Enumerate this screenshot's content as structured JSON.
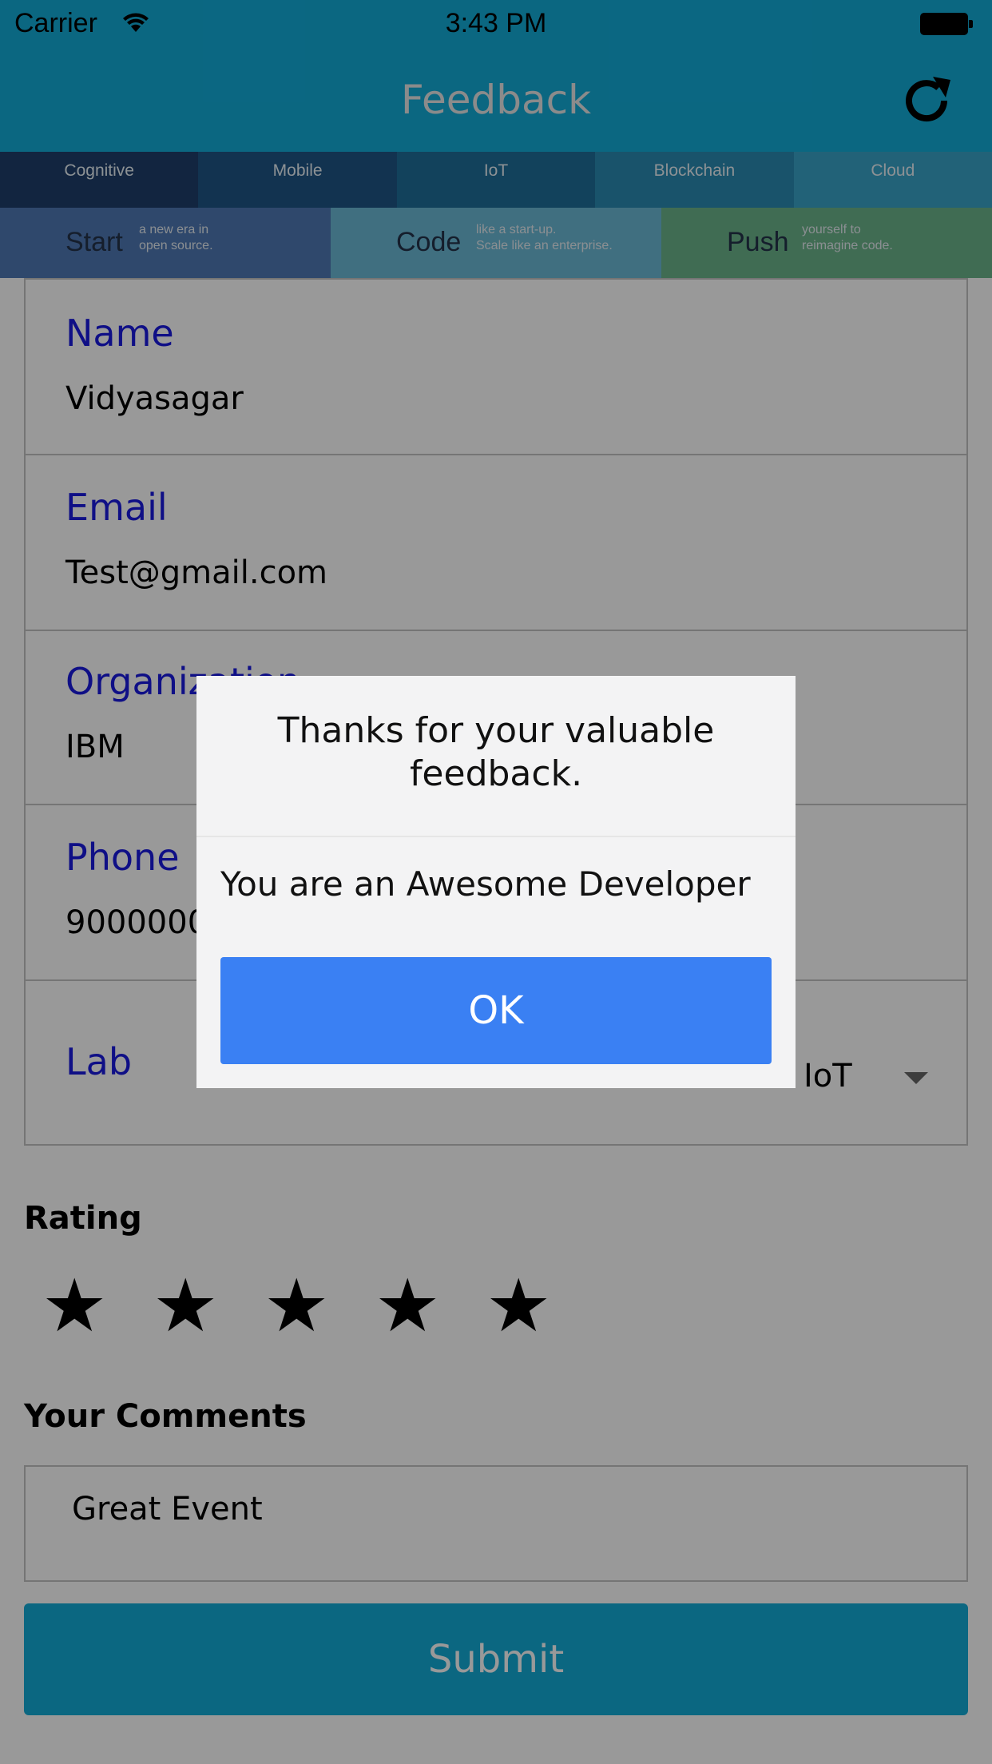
{
  "status_bar": {
    "carrier": "Carrier",
    "time": "3:43 PM"
  },
  "nav": {
    "title": "Feedback",
    "refresh_icon": "refresh-icon"
  },
  "banner": {
    "categories": [
      "Cognitive",
      "Mobile",
      "IoT",
      "Blockchain",
      "Cloud"
    ],
    "taglines": [
      {
        "big": "Start",
        "small1": "a new era in",
        "small2": "open source."
      },
      {
        "big": "Code",
        "small1": "like a start-up.",
        "small2": "Scale like an enterprise."
      },
      {
        "big": "Push",
        "small1": "yourself to",
        "small2": "reimagine code."
      }
    ]
  },
  "form": {
    "name": {
      "label": "Name",
      "value": "Vidyasagar"
    },
    "email": {
      "label": "Email",
      "value": "Test@gmail.com"
    },
    "organization": {
      "label": "Organization",
      "value": "IBM"
    },
    "phone": {
      "label": "Phone",
      "value": "9000000"
    },
    "lab": {
      "label": "Lab",
      "value": "IoT"
    }
  },
  "rating": {
    "label": "Rating",
    "value": 5,
    "max": 5
  },
  "comments": {
    "label": "Your Comments",
    "value": "Great Event"
  },
  "submit_label": "Submit",
  "dialog": {
    "title_line1": "Thanks for your valuable",
    "title_line2": "feedback.",
    "message": "You are an Awesome Developer",
    "ok_label": "OK"
  },
  "colors": {
    "primary": "#13acd8",
    "label_blue": "#1a1ae0",
    "ok_button": "#3a80f3"
  }
}
